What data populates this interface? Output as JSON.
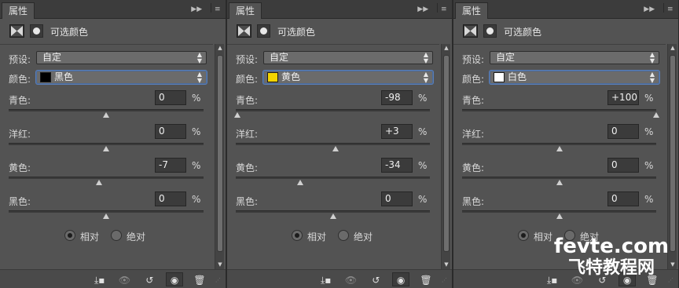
{
  "panels": [
    {
      "tab_label": "属性",
      "title": "可选颜色",
      "preset_label": "预设:",
      "preset_value": "自定",
      "color_label": "颜色:",
      "color_value": "黑色",
      "swatch_color": "#000000",
      "sliders": [
        {
          "label": "青色:",
          "value": "0",
          "unit": "%",
          "level": 0
        },
        {
          "label": "洋红:",
          "value": "0",
          "unit": "%",
          "level": 0
        },
        {
          "label": "黄色:",
          "value": "-7",
          "unit": "%",
          "level": -7
        },
        {
          "label": "黑色:",
          "value": "0",
          "unit": "%",
          "level": 0
        }
      ],
      "radio_relative": "相对",
      "radio_absolute": "绝对",
      "selected": "relative"
    },
    {
      "tab_label": "属性",
      "title": "可选颜色",
      "preset_label": "预设:",
      "preset_value": "自定",
      "color_label": "颜色:",
      "color_value": "黄色",
      "swatch_color": "#f3d400",
      "sliders": [
        {
          "label": "青色:",
          "value": "-98",
          "unit": "%",
          "level": -98
        },
        {
          "label": "洋红:",
          "value": "+3",
          "unit": "%",
          "level": 3
        },
        {
          "label": "黄色:",
          "value": "-34",
          "unit": "%",
          "level": -34
        },
        {
          "label": "黑色:",
          "value": "0",
          "unit": "%",
          "level": 0
        }
      ],
      "radio_relative": "相对",
      "radio_absolute": "绝对",
      "selected": "relative"
    },
    {
      "tab_label": "属性",
      "title": "可选颜色",
      "preset_label": "预设:",
      "preset_value": "自定",
      "color_label": "颜色:",
      "color_value": "白色",
      "swatch_color": "#ffffff",
      "sliders": [
        {
          "label": "青色:",
          "value": "+100",
          "unit": "%",
          "level": 100
        },
        {
          "label": "洋红:",
          "value": "0",
          "unit": "%",
          "level": 0
        },
        {
          "label": "黄色:",
          "value": "0",
          "unit": "%",
          "level": 0
        },
        {
          "label": "黑色:",
          "value": "0",
          "unit": "%",
          "level": 0
        }
      ],
      "radio_relative": "相对",
      "radio_absolute": "绝对",
      "selected": "relative"
    }
  ],
  "watermark": {
    "line1": "fevte.com",
    "line2": "飞特教程网"
  }
}
